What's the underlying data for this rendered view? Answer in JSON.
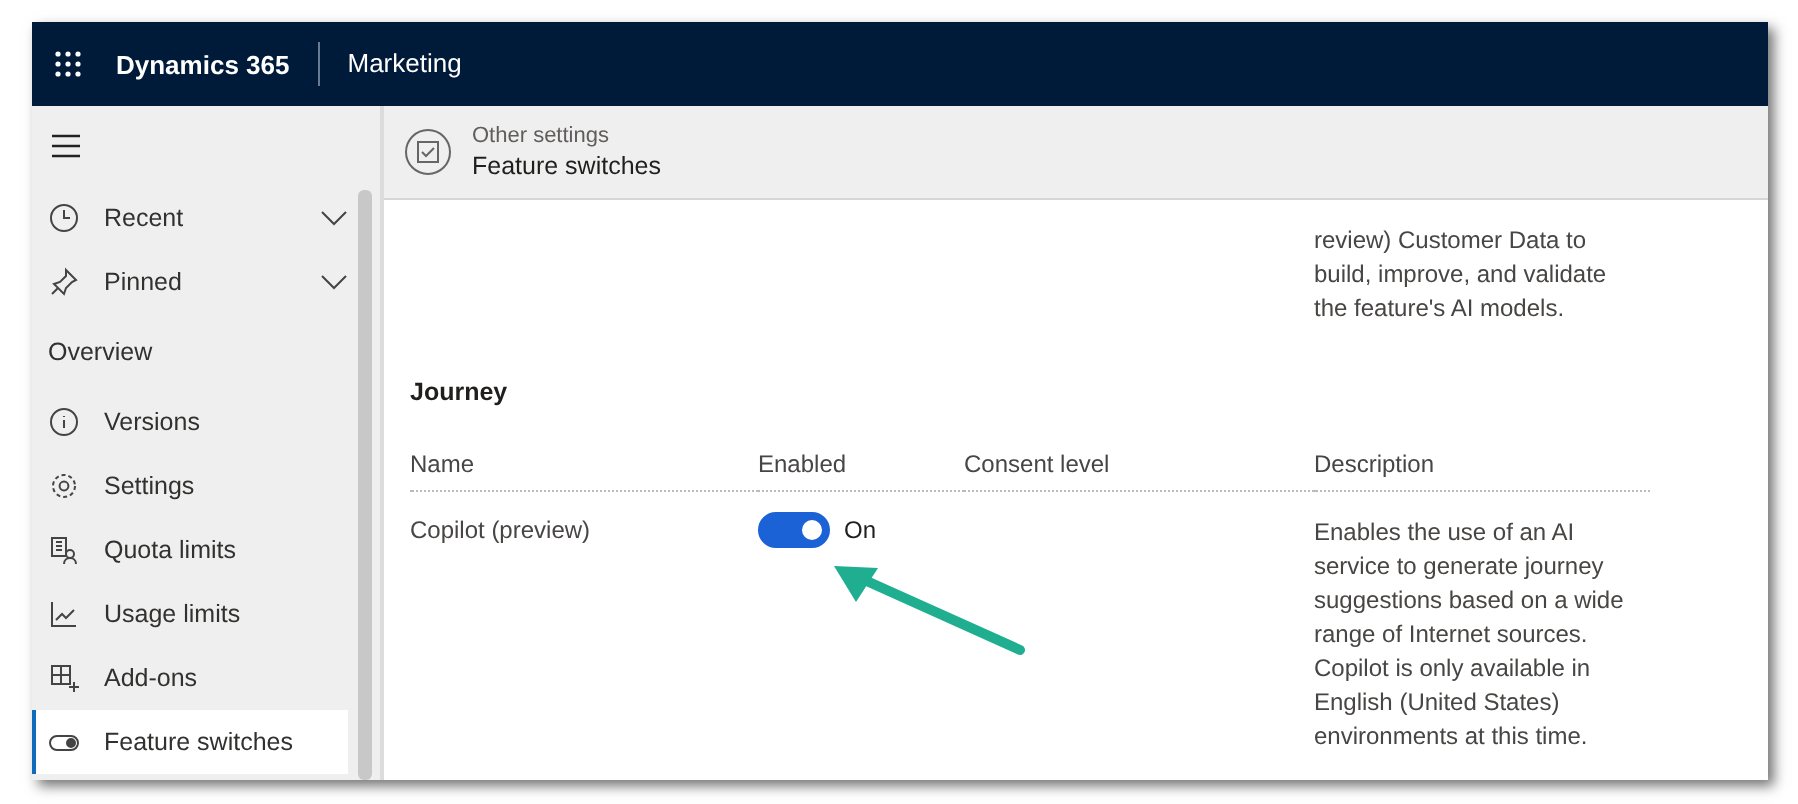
{
  "app": {
    "name": "Dynamics 365",
    "area": "Marketing"
  },
  "sidebar": {
    "groups": [
      {
        "label": "Recent",
        "expanded": false
      },
      {
        "label": "Pinned",
        "expanded": false
      }
    ],
    "section": "Overview",
    "items": [
      {
        "label": "Versions",
        "selected": false
      },
      {
        "label": "Settings",
        "selected": false
      },
      {
        "label": "Quota limits",
        "selected": false
      },
      {
        "label": "Usage limits",
        "selected": false
      },
      {
        "label": "Add-ons",
        "selected": false
      },
      {
        "label": "Feature switches",
        "selected": true
      }
    ]
  },
  "header": {
    "breadcrumb": "Other settings",
    "title": "Feature switches"
  },
  "content": {
    "previous_description": "review) Customer Data to build, improve, and validate the feature's AI models.",
    "section": "Journey",
    "columns": [
      "Name",
      "Enabled",
      "Consent level",
      "Description"
    ],
    "rows": [
      {
        "name": "Copilot (preview)",
        "enabled": true,
        "state_label": "On",
        "description": "Enables the use of an AI service to generate journey suggestions based on a wide range of Internet sources. Copilot is only available in English (United States) environments at this time."
      }
    ]
  }
}
